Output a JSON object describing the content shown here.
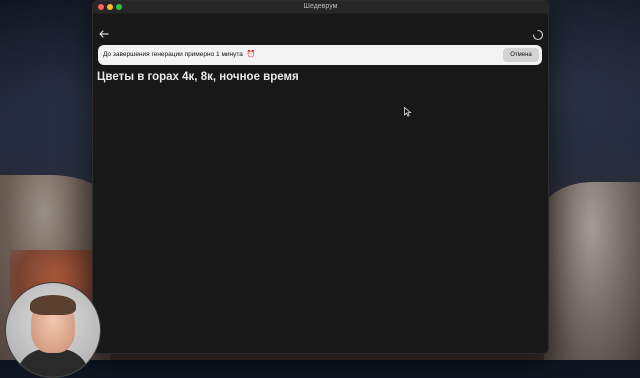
{
  "window": {
    "title": "Шедеврум"
  },
  "toolbar": {
    "back_icon": "arrow-left-icon",
    "status_icon": "loading-spinner-icon"
  },
  "banner": {
    "text": "До завершения генерации примерно 1 минута",
    "emoji": "⏰",
    "cancel_label": "Отмена"
  },
  "prompt": {
    "title": "Цветы в горах 4к, 8к, ночное время"
  },
  "colors": {
    "window_bg": "#181818",
    "banner_bg": "#f3f3f3",
    "cancel_bg": "#d3d3d3",
    "title_text": "#e8e8e8"
  }
}
